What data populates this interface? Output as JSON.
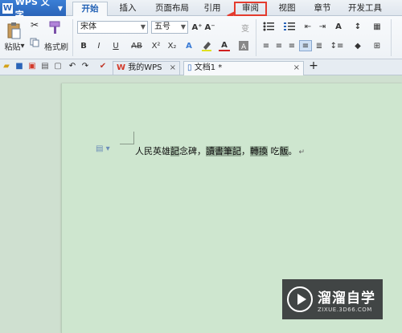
{
  "app": {
    "title": "WPS 文字",
    "logo": "W"
  },
  "menu_tabs": [
    "开始",
    "插入",
    "页面布局",
    "引用",
    "审阅",
    "视图",
    "章节",
    "开发工具"
  ],
  "ribbon": {
    "paste_label": "粘贴",
    "format_painter_label": "格式刷",
    "font_name": "宋体",
    "font_size": "五号",
    "bold": "B",
    "italic": "I",
    "underline": "U",
    "strikethrough": "AB",
    "superscript": "X²",
    "subscript": "X₂",
    "grow_font": "A⁺",
    "shrink_font": "A⁻",
    "font_color_letter": "A"
  },
  "doc_tabs": [
    {
      "label": "我的WPS"
    },
    {
      "label": "文档1 *"
    }
  ],
  "document": {
    "pre": "人民英雄",
    "h1": "記",
    "t1": "念碑，",
    "h2": "讀書筆記",
    "t2": "，",
    "h3": "轉換",
    "t3": " 吃",
    "h4": "飯",
    "t4": "。"
  },
  "watermark": {
    "title": "溜溜自学",
    "url": "ZIXUE.3D66.COM"
  },
  "colors": {
    "app_blue": "#2a64b8",
    "active_tab_text": "#1f5fb4",
    "highlight_red": "#e43b2e",
    "page_bg": "#cee6cf"
  }
}
